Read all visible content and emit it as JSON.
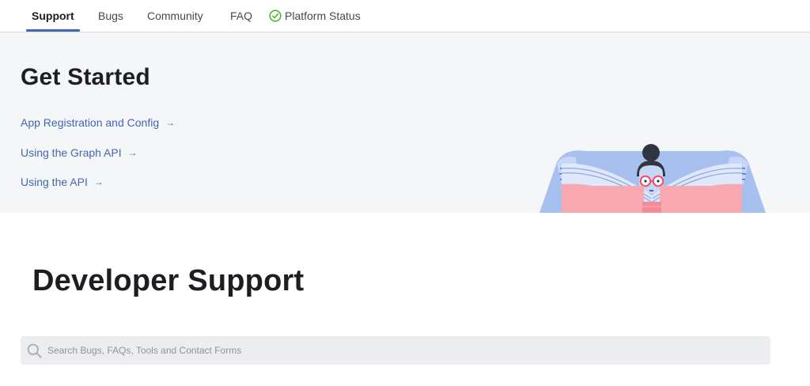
{
  "nav": {
    "items": [
      {
        "label": "Support",
        "active": true
      },
      {
        "label": "Bugs"
      },
      {
        "label": "Community"
      },
      {
        "label": "FAQ"
      }
    ],
    "status": {
      "label": "Platform Status",
      "icon": "check-circle-icon",
      "color": "#42b72a"
    }
  },
  "hero": {
    "title": "Get Started",
    "links": [
      {
        "label": "App Registration and Config",
        "arrow": "→"
      },
      {
        "label": "Using the Graph API",
        "arrow": "→"
      },
      {
        "label": "Using the API",
        "arrow": "→"
      }
    ],
    "illustration": "person-reading-book-illustration"
  },
  "main": {
    "title": "Developer Support",
    "search": {
      "placeholder": "Search Bugs, FAQs, Tools and Contact Forms",
      "value": "",
      "icon": "search-icon"
    }
  },
  "colors": {
    "accent": "#4267b2",
    "hero_bg": "#f5f6f7",
    "search_bg": "#ebedf0",
    "status_green": "#42b72a"
  }
}
